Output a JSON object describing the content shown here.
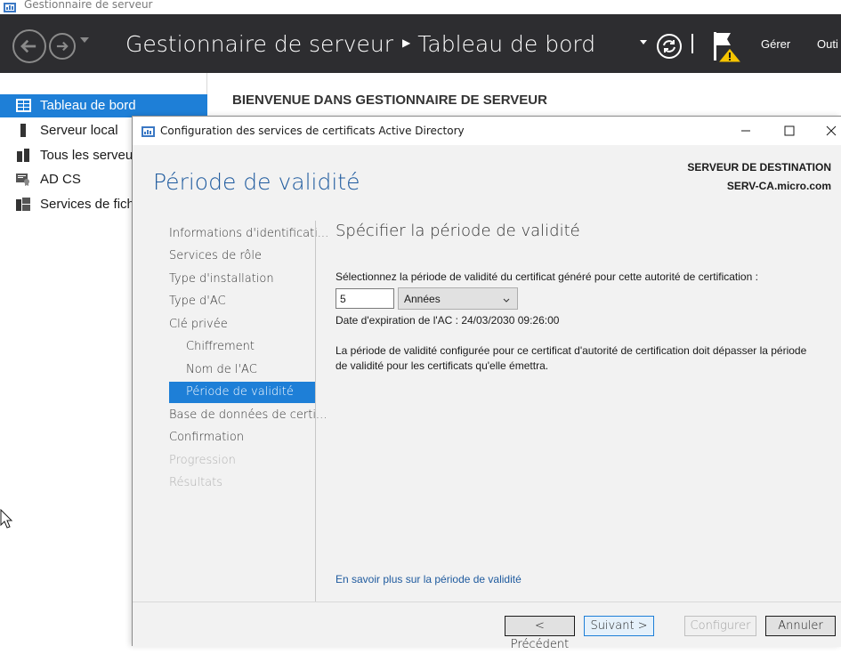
{
  "app": {
    "window_title": "Gestionnaire de serveur",
    "breadcrumb_root": "Gestionnaire de serveur",
    "breadcrumb_current": "Tableau de bord",
    "menu": [
      "Gérer",
      "Outi"
    ]
  },
  "sidebar": {
    "items": [
      {
        "label": "Tableau de bord",
        "icon": "dashboard-icon",
        "active": true
      },
      {
        "label": "Serveur local",
        "icon": "server-icon",
        "active": false
      },
      {
        "label": "Tous les serveurs",
        "icon": "servers-icon",
        "active": false
      },
      {
        "label": "AD CS",
        "icon": "certificate-icon",
        "active": false
      },
      {
        "label": "Services de fichiers",
        "icon": "file-services-icon",
        "active": false
      }
    ]
  },
  "main": {
    "welcome": "BIENVENUE DANS GESTIONNAIRE DE SERVEUR"
  },
  "dialog": {
    "title": "Configuration des services de certificats Active Directory",
    "page_heading": "Période de validité",
    "destination_label": "SERVEUR DE DESTINATION",
    "destination_value": "SERV-CA.micro.com",
    "steps": [
      {
        "label": "Informations d'identificati...",
        "state": "normal",
        "sub": false
      },
      {
        "label": "Services de rôle",
        "state": "normal",
        "sub": false
      },
      {
        "label": "Type d'installation",
        "state": "normal",
        "sub": false
      },
      {
        "label": "Type d'AC",
        "state": "normal",
        "sub": false
      },
      {
        "label": "Clé privée",
        "state": "normal",
        "sub": false
      },
      {
        "label": "Chiffrement",
        "state": "normal",
        "sub": true
      },
      {
        "label": "Nom de l'AC",
        "state": "normal",
        "sub": true
      },
      {
        "label": "Période de validité",
        "state": "active",
        "sub": true
      },
      {
        "label": "Base de données de certi...",
        "state": "normal",
        "sub": false
      },
      {
        "label": "Confirmation",
        "state": "normal",
        "sub": false
      },
      {
        "label": "Progression",
        "state": "disabled",
        "sub": false
      },
      {
        "label": "Résultats",
        "state": "disabled",
        "sub": false
      }
    ],
    "content_heading": "Spécifier la période de validité",
    "prompt": "Sélectionnez la période de validité du certificat généré pour cette autorité de certification :",
    "validity_value": "5",
    "validity_unit": "Années",
    "expiry": "Date d'expiration de l'AC : 24/03/2030 09:26:00",
    "info": "La période de validité configurée pour ce certificat d'autorité de certification doit dépasser la période de validité pour les certificats qu'elle émettra.",
    "learn_more": "En savoir plus sur la période de validité",
    "buttons": {
      "previous": "< Précédent",
      "next": "Suivant >",
      "configure": "Configurer",
      "cancel": "Annuler"
    }
  },
  "colors": {
    "accent": "#1e7fd7",
    "header_bg": "#2d2d30",
    "heading_blue": "#1e5a9e",
    "warning": "#f5c400"
  }
}
